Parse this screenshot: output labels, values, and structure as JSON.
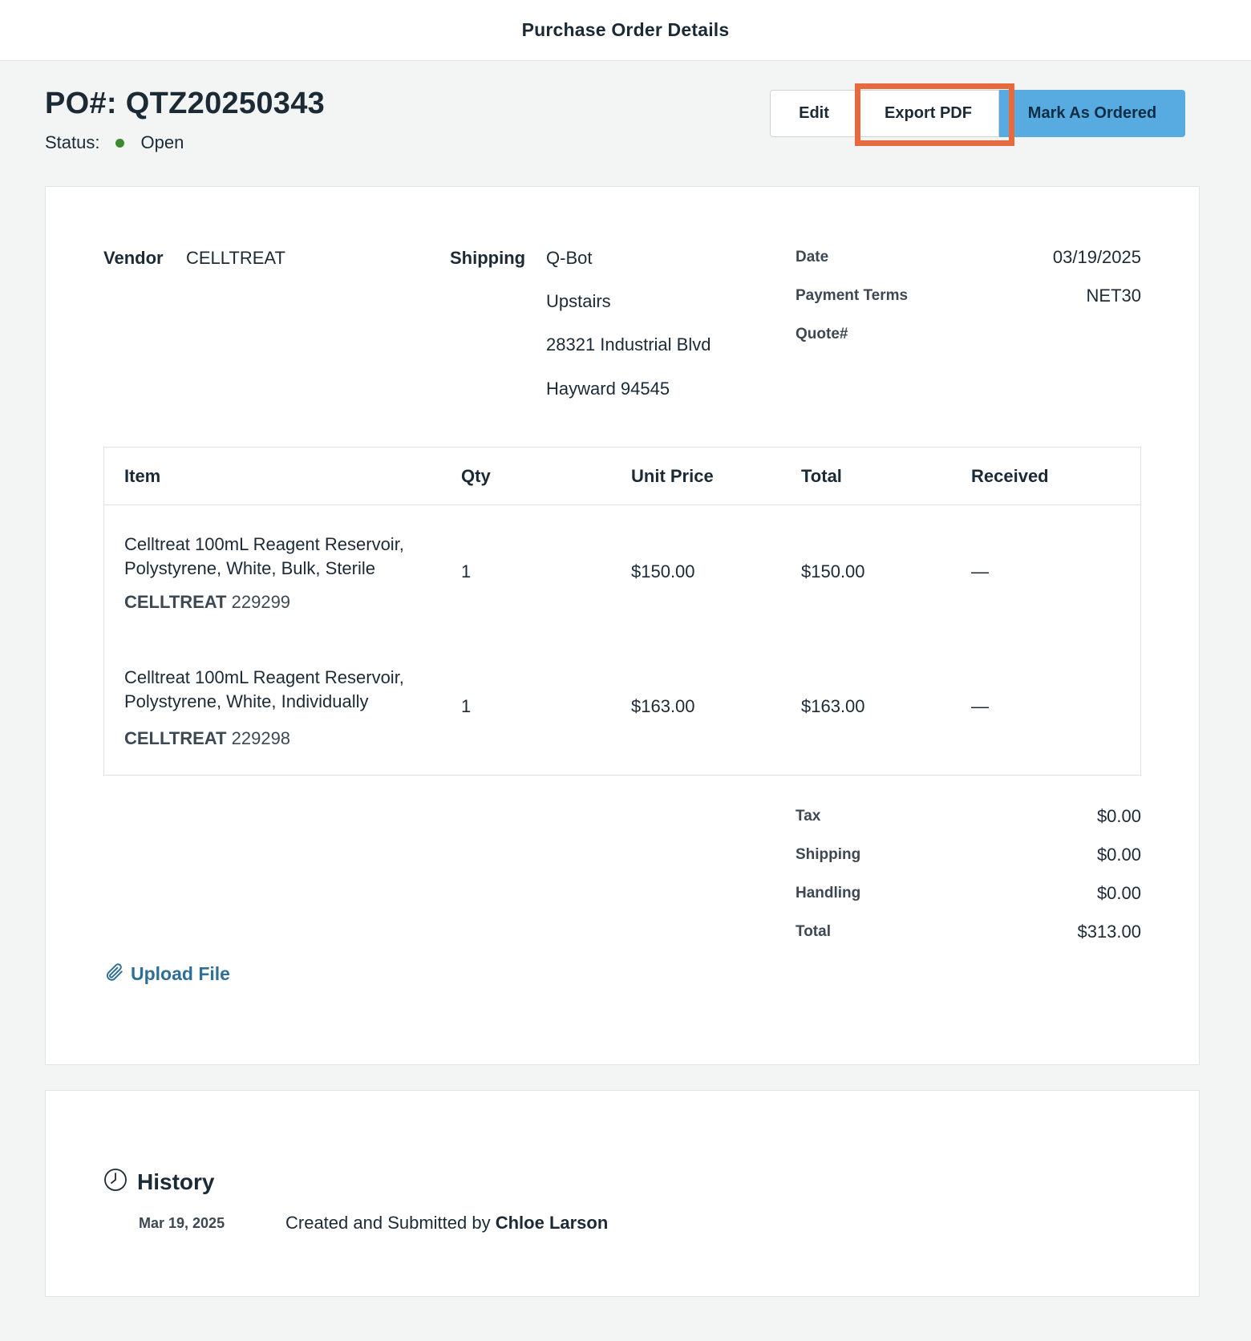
{
  "header": {
    "title": "Purchase Order Details"
  },
  "po": {
    "number": "PO#: QTZ20250343",
    "status_label": "Status:",
    "status_value": "Open",
    "status_color": "#3e8a2e"
  },
  "actions": {
    "edit": "Edit",
    "export_pdf": "Export PDF",
    "mark_ordered": "Mark As Ordered"
  },
  "vendor": {
    "label": "Vendor",
    "value": "CELLTREAT"
  },
  "shipping": {
    "label": "Shipping",
    "lines": [
      "Q-Bot",
      "Upstairs",
      "28321 Industrial Blvd",
      "Hayward 94545"
    ]
  },
  "meta": {
    "date_label": "Date",
    "date_value": "03/19/2025",
    "terms_label": "Payment Terms",
    "terms_value": "NET30",
    "quote_label": "Quote#",
    "quote_value": ""
  },
  "table": {
    "headers": [
      "Item",
      "Qty",
      "Unit Price",
      "Total",
      "Received"
    ],
    "rows": [
      {
        "desc": "Celltreat 100mL Reagent Reservoir, Polystyrene, White, Bulk, Sterile",
        "brand": "CELLTREAT",
        "sku": "229299",
        "qty": "1",
        "unit_price": "$150.00",
        "total": "$150.00",
        "received": "—"
      },
      {
        "desc": "Celltreat 100mL Reagent Reservoir, Polystyrene, White, Individually",
        "brand": "CELLTREAT",
        "sku": "229298",
        "qty": "1",
        "unit_price": "$163.00",
        "total": "$163.00",
        "received": "—"
      }
    ]
  },
  "totals": {
    "tax_label": "Tax",
    "tax_value": "$0.00",
    "shipping_label": "Shipping",
    "shipping_value": "$0.00",
    "handling_label": "Handling",
    "handling_value": "$0.00",
    "total_label": "Total",
    "total_value": "$313.00"
  },
  "upload": {
    "label": "Upload File",
    "icon": "paperclip-icon"
  },
  "history": {
    "title": "History",
    "icon": "clock-icon",
    "entries": [
      {
        "date": "Mar 19, 2025",
        "text": "Created and Submitted by ",
        "user": "Chloe Larson"
      }
    ]
  },
  "colors": {
    "accent": "#58abe0",
    "highlight": "#e8693c",
    "link": "#2f6e96"
  }
}
